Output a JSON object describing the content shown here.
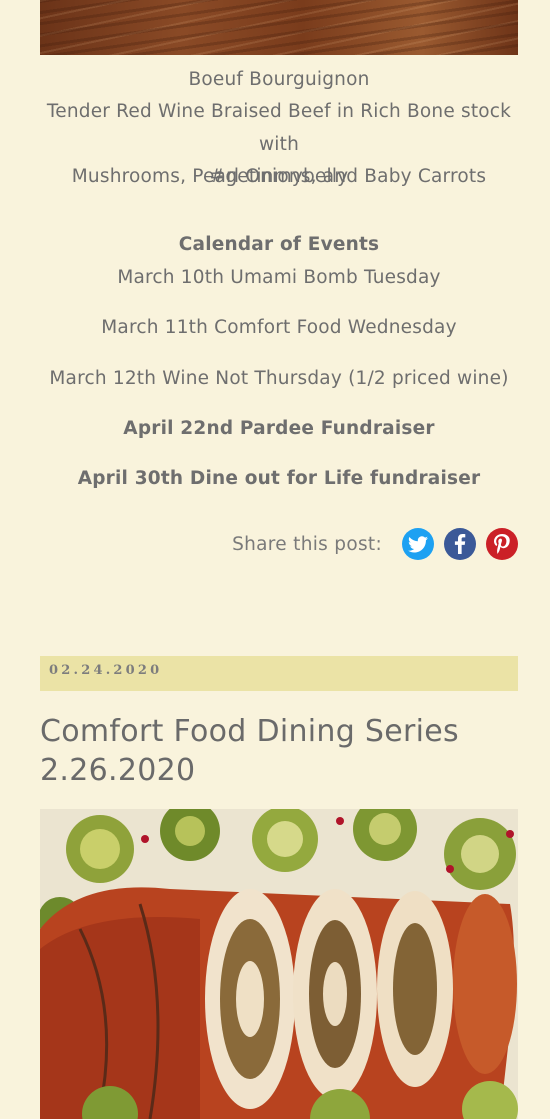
{
  "post1": {
    "dish_title": "Boeuf Bourguignon",
    "dish_desc_line1": "Tender Red Wine Braised Beef in Rich Bone stock with",
    "dish_desc_line2": "Mushrooms, Pearl Onions, and Baby Carrots",
    "hashtag": "#getinmybelly",
    "calendar_heading": "Calendar of Events",
    "events": [
      {
        "text": "March 10th Umami Bomb Tuesday",
        "bold": false
      },
      {
        "text": "March 11th Comfort Food Wednesday",
        "bold": false
      },
      {
        "text": "March 12th Wine Not Thursday (1/2 priced wine)",
        "bold": false
      },
      {
        "text": "April 22nd Pardee Fundraiser",
        "bold": true
      },
      {
        "text": "April 30th Dine out for Life fundraiser",
        "bold": true
      }
    ],
    "share_label": "Share this post:",
    "share_buttons": [
      {
        "icon": "twitter-icon",
        "color": "#1da1f2"
      },
      {
        "icon": "facebook-icon",
        "color": "#3b5998"
      },
      {
        "icon": "pinterest-icon",
        "color": "#cb2027"
      }
    ]
  },
  "post2": {
    "date": "02.24.2020",
    "title_line1": "Comfort Food Dining Series",
    "title_line2": "2.26.2020"
  },
  "colors": {
    "background": "#f9f3dc",
    "date_bar": "#ebe3a6",
    "text": "#6e6e6e"
  }
}
